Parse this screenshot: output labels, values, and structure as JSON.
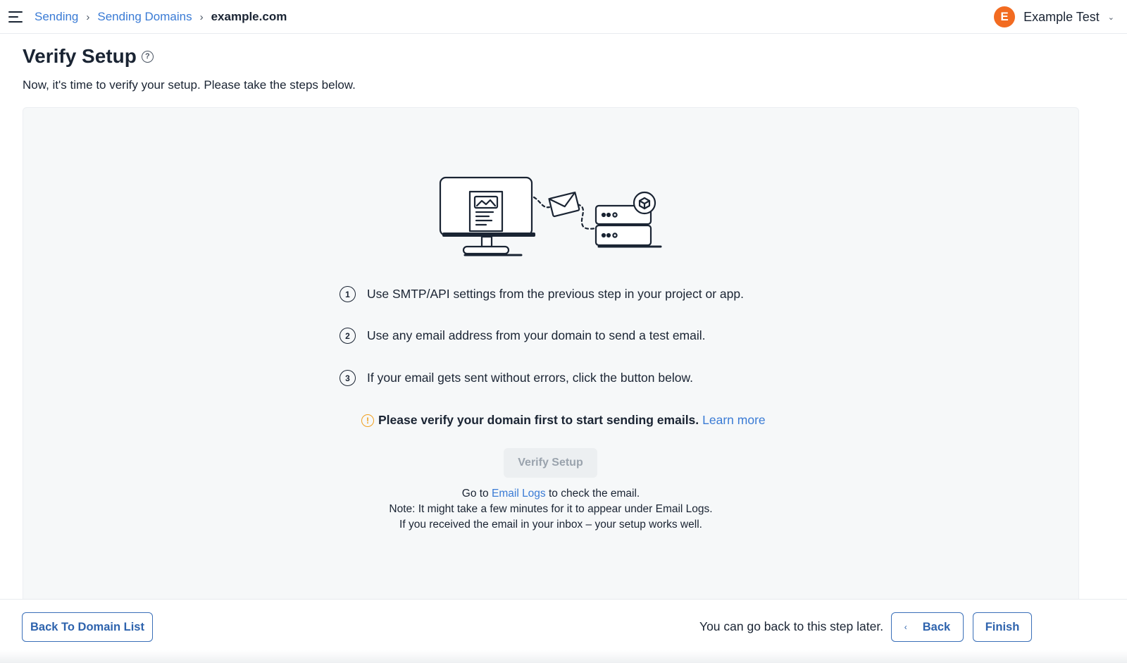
{
  "breadcrumb": {
    "items": [
      "Sending",
      "Sending Domains"
    ],
    "current": "example.com"
  },
  "user": {
    "initial": "E",
    "name": "Example Test"
  },
  "page": {
    "title": "Verify Setup",
    "subtitle": "Now, it's time to verify your setup. Please take the steps below."
  },
  "steps": [
    {
      "num": "1",
      "text": "Use SMTP/API settings from the previous step in your project or app."
    },
    {
      "num": "2",
      "text": "Use any email address from your domain to send a test email."
    },
    {
      "num": "3",
      "text": "If your email gets sent without errors, click the button below."
    }
  ],
  "warning": {
    "text": "Please verify your domain first to start sending emails.",
    "link": "Learn more"
  },
  "verify_button": "Verify Setup",
  "notes": {
    "line1_prefix": "Go to",
    "line1_link": "Email Logs",
    "line1_suffix": "to check the email.",
    "line2": "Note: It might take a few minutes for it to appear under Email Logs.",
    "line3": "If you received the email in your inbox – your setup works well."
  },
  "footer": {
    "back_to_list": "Back To Domain List",
    "hint": "You can go back to this step later.",
    "back": "Back",
    "finish": "Finish"
  },
  "colors": {
    "link": "#3a7bd5",
    "avatar": "#f26b21",
    "warning": "#f0a020",
    "panel": "#f6f8f9"
  }
}
